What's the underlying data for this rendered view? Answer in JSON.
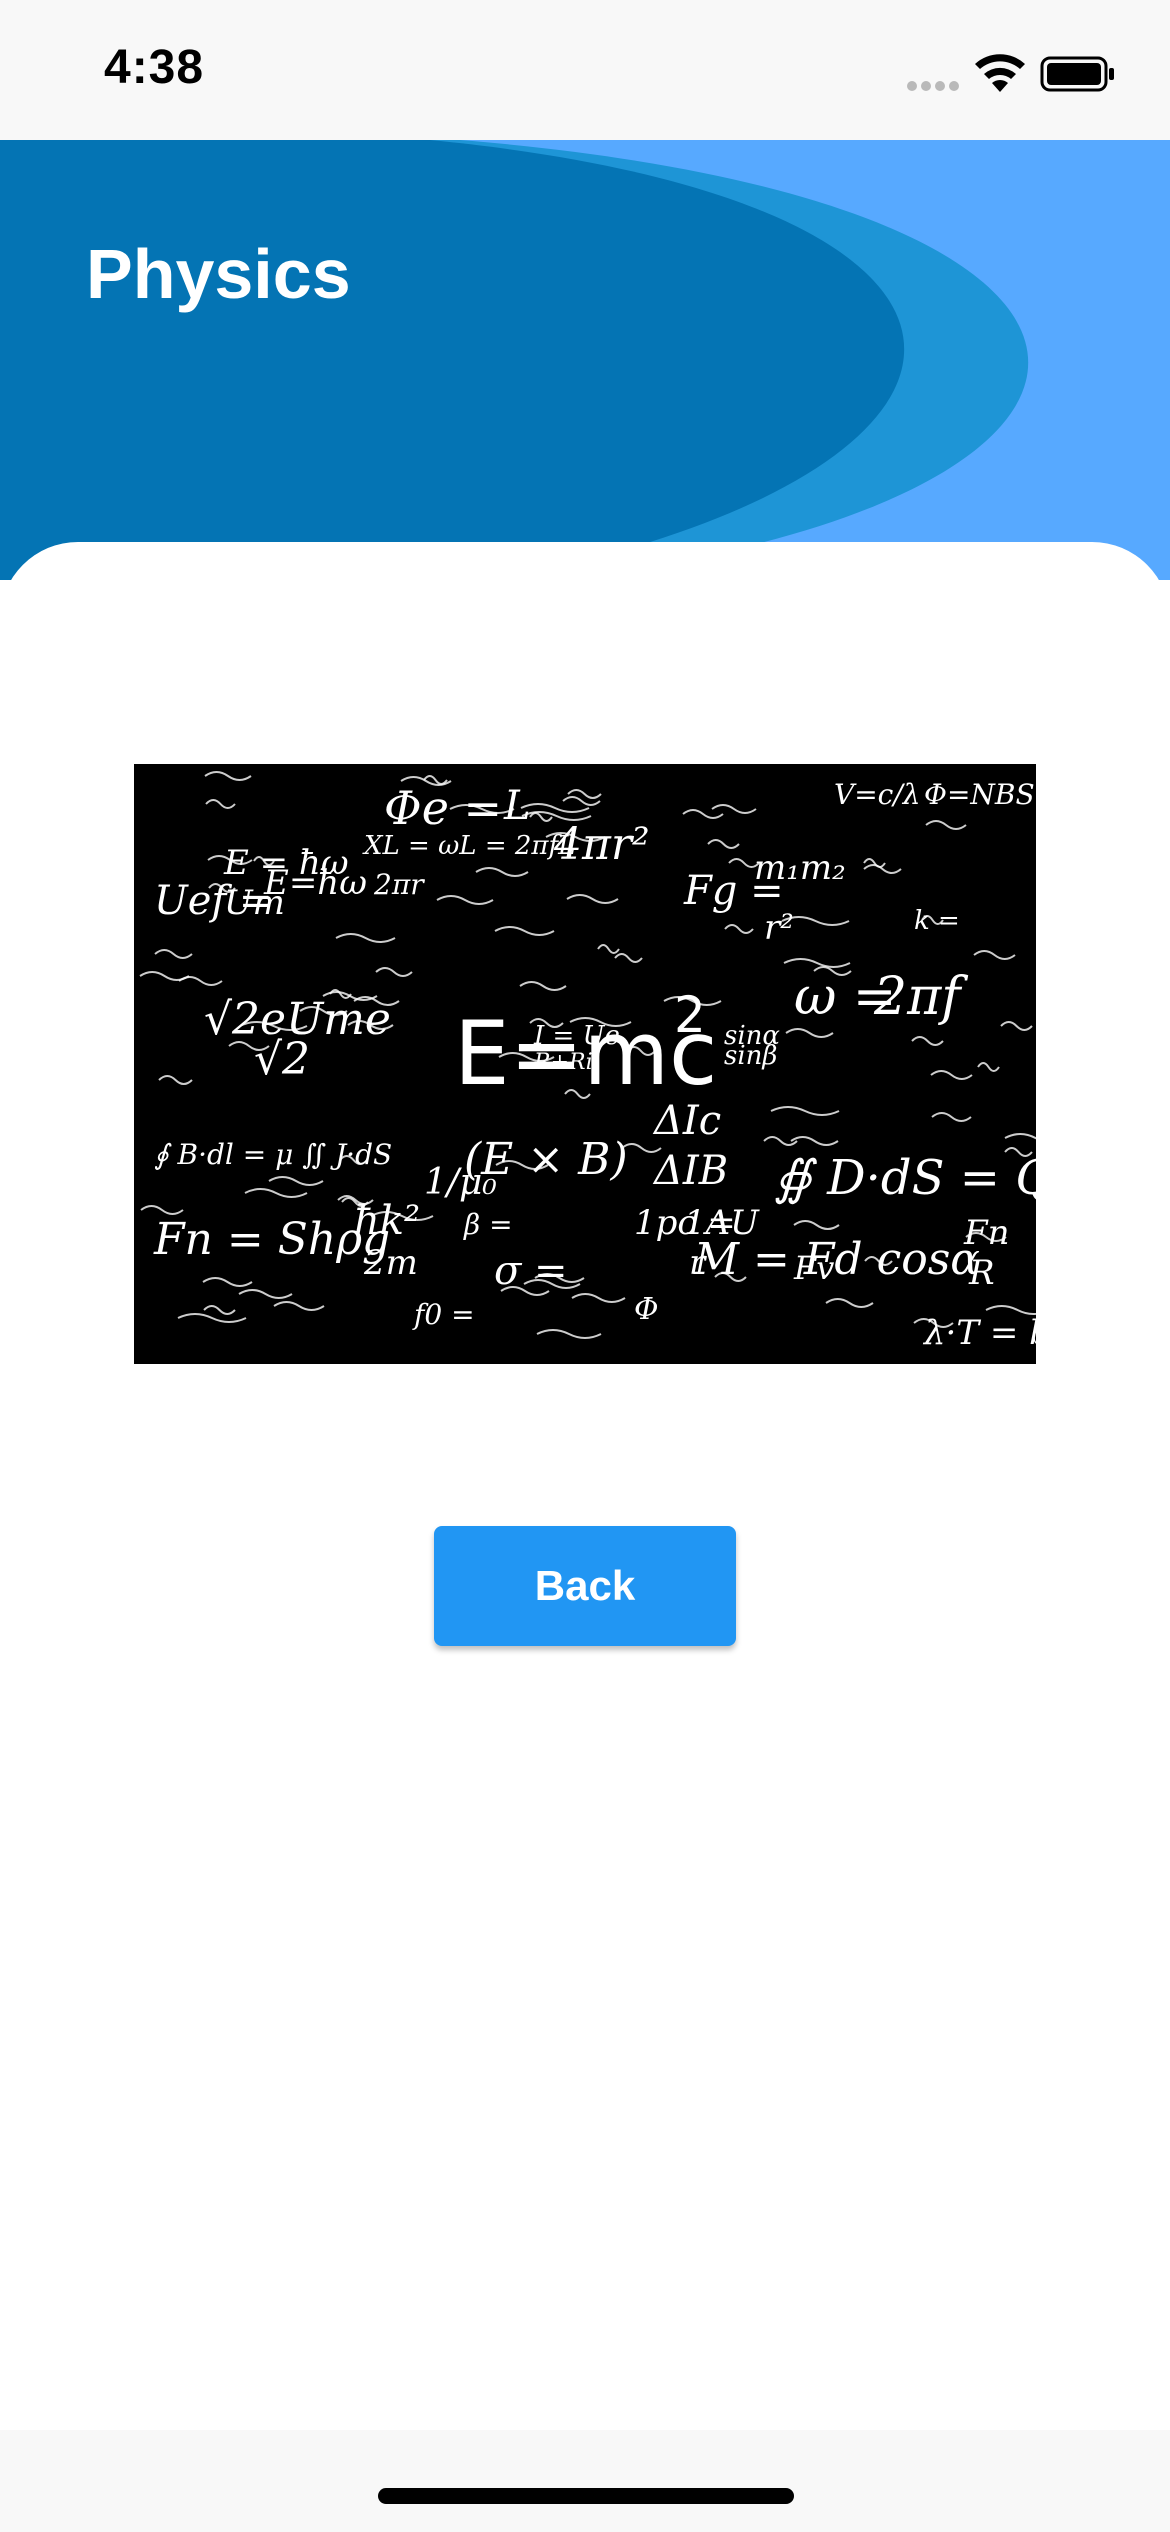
{
  "status_bar": {
    "time": "4:38"
  },
  "header": {
    "title": "Physics"
  },
  "image": {
    "alt": "Physics formulas chalkboard",
    "center_formula": "E=mc",
    "center_exponent": "2",
    "formulas": [
      "Φe =",
      "L",
      "4πr²",
      "E=ħω",
      "Uef =",
      "Um",
      "√2",
      "2πf",
      "ω =",
      "V=c/λ",
      "Φ=NBS",
      "Fg =",
      "m₁m₂",
      "r²",
      "√2eUme",
      "∮ B·dl = μ ∬ J·dS",
      "(E × B)",
      "1/μ₀",
      "ΔIc",
      "ΔIB",
      "∯ D·dS = Q",
      "Fn = Shρg",
      "ħk²",
      "2m",
      "1pc =",
      "1AU",
      "r",
      "M = Fd cosα",
      "Fn",
      "R",
      "λ·T = b",
      "sinα",
      "sinβ",
      "2πr",
      "Fv",
      "σ =",
      "Φ",
      "f0 =",
      "XL = ωL = 2πfL",
      "E = ħω",
      "k =",
      "β =",
      "I = Ue",
      "R+Ri"
    ]
  },
  "back_button": {
    "label": "Back"
  },
  "colors": {
    "header_light": "#57a9ff",
    "header_mid": "#1e95d6",
    "header_dark": "#0474b4",
    "button": "#2196f3"
  },
  "icons": {
    "signal": "signal-dots-icon",
    "wifi": "wifi-icon",
    "battery": "battery-icon"
  }
}
